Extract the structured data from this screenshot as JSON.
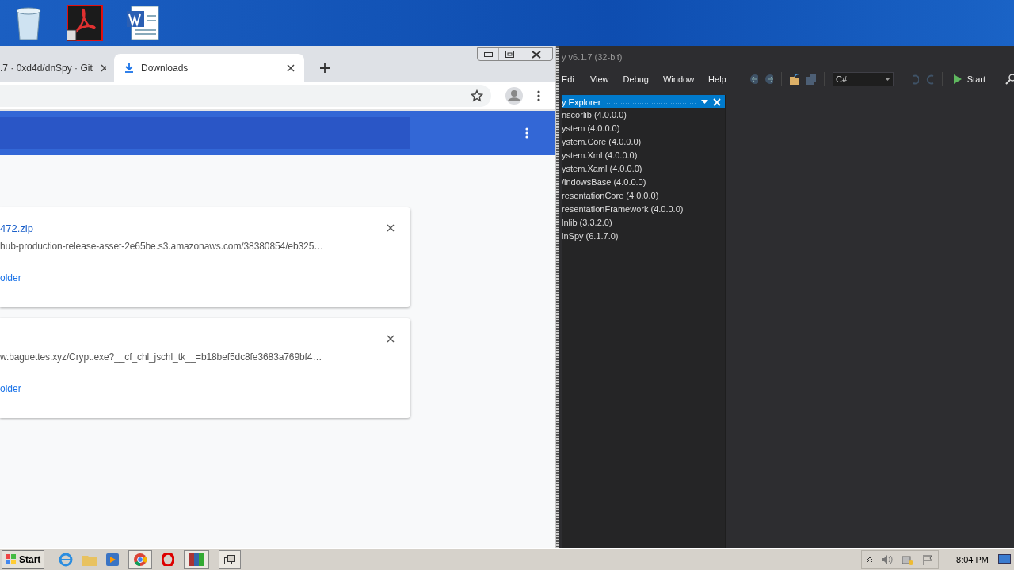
{
  "taskbar": {
    "start": "Start",
    "clock": "8:04 PM"
  },
  "browser": {
    "tabs": [
      {
        "label": ".7 · 0xd4d/dnSpy · Git",
        "selected": false
      },
      {
        "label": "Downloads",
        "selected": true
      }
    ],
    "downloads": [
      {
        "name": "472.zip",
        "url": "hub-production-release-asset-2e65be.s3.amazonaws.com/38380854/eb325…",
        "link": "older"
      },
      {
        "url": "w.baguettes.xyz/Crypt.exe?__cf_chl_jschl_tk__=b18bef5dc8fe3683a769bf4…",
        "link": "older"
      }
    ]
  },
  "dnspy": {
    "title": "y v6.1.7 (32-bit)",
    "menu": [
      "Edi",
      "View",
      "Debug",
      "Window",
      "Help"
    ],
    "language": "C#",
    "start": "Start",
    "panel_title": "y Explorer",
    "assemblies": [
      "nscorlib (4.0.0.0)",
      "ystem (4.0.0.0)",
      "ystem.Core (4.0.0.0)",
      "ystem.Xml (4.0.0.0)",
      "ystem.Xaml (4.0.0.0)",
      "/indowsBase (4.0.0.0)",
      "resentationCore (4.0.0.0)",
      "resentationFramework (4.0.0.0)",
      "lnlib (3.3.2.0)",
      "lnSpy (6.1.7.0)"
    ]
  }
}
